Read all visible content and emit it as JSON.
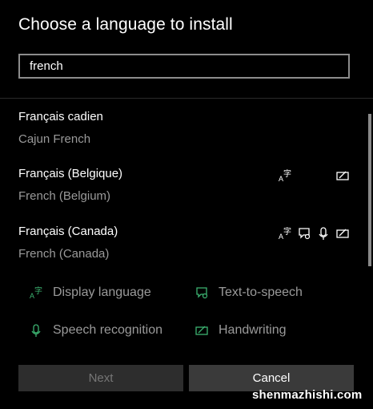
{
  "title": "Choose a language to install",
  "search": {
    "value": "french"
  },
  "languages": [
    {
      "name": "Français cadien",
      "english": "Cajun French",
      "features": []
    },
    {
      "name": "Français (Belgique)",
      "english": "French (Belgium)",
      "features": [
        "display-language-icon",
        "handwriting-icon"
      ]
    },
    {
      "name": "Français (Canada)",
      "english": "French (Canada)",
      "features": [
        "display-language-icon",
        "text-to-speech-icon",
        "speech-recognition-icon",
        "handwriting-icon"
      ]
    }
  ],
  "legend": {
    "display_language": "Display language",
    "text_to_speech": "Text-to-speech",
    "speech_recognition": "Speech recognition",
    "handwriting": "Handwriting"
  },
  "buttons": {
    "next": "Next",
    "cancel": "Cancel"
  },
  "watermark": "shenmazhishi.com",
  "colors": {
    "background": "#000000",
    "accent_green": "#3cb371",
    "muted_text": "#9a9a9a"
  }
}
